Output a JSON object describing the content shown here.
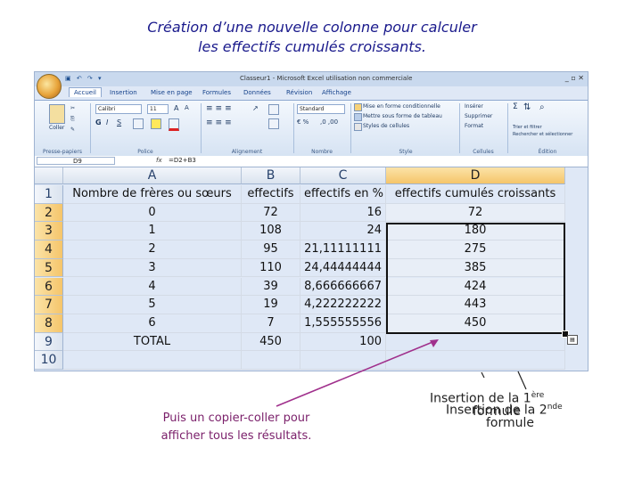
{
  "slide": {
    "title_line1": "Création d’une nouvelle colonne pour calculer",
    "title_line2": "les effectifs cumulés croissants."
  },
  "window": {
    "title": "Classeur1 - Microsoft Excel utilisation non commerciale",
    "tabs": [
      "Accueil",
      "Insertion",
      "Mise en page",
      "Formules",
      "Données",
      "Révision",
      "Affichage"
    ],
    "active_tab": "Accueil"
  },
  "ribbon": {
    "paste_label": "Coller",
    "font_name": "Calibri",
    "font_size": "11",
    "number_format": "Standard",
    "styles": [
      "Mise en forme conditionnelle",
      "Mettre sous forme de tableau",
      "Styles de cellules"
    ],
    "cells": [
      "Insérer",
      "Supprimer",
      "Format"
    ],
    "editing": [
      "Trier et filtrer",
      "Rechercher et sélectionner"
    ],
    "group_labels": [
      "Presse-papiers",
      "Police",
      "Alignement",
      "Nombre",
      "Style",
      "Cellules",
      "Édition"
    ]
  },
  "formula_bar": {
    "name_box": "D9",
    "fx": "fx",
    "value": "=D2+B3"
  },
  "grid": {
    "columns": [
      "A",
      "B",
      "C",
      "D"
    ],
    "selected_column": "D",
    "rows": [
      {
        "n": "1",
        "a": "Nombre de frères ou sœurs",
        "b": "effectifs",
        "c": "effectifs en %",
        "d": "effectifs cumulés croissants"
      },
      {
        "n": "2",
        "a": "0",
        "b": "72",
        "c": "16",
        "d": "72"
      },
      {
        "n": "3",
        "a": "1",
        "b": "108",
        "c": "24",
        "d": "180"
      },
      {
        "n": "4",
        "a": "2",
        "b": "95",
        "c": "21,11111111",
        "d": "275"
      },
      {
        "n": "5",
        "a": "3",
        "b": "110",
        "c": "24,44444444",
        "d": "385"
      },
      {
        "n": "6",
        "a": "4",
        "b": "39",
        "c": "8,666666667",
        "d": "424"
      },
      {
        "n": "7",
        "a": "5",
        "b": "19",
        "c": "4,222222222",
        "d": "443"
      },
      {
        "n": "8",
        "a": "6",
        "b": "7",
        "c": "1,555555556",
        "d": "450"
      },
      {
        "n": "9",
        "a": "TOTAL",
        "b": "450",
        "c": "100",
        "d": ""
      },
      {
        "n": "10",
        "a": "",
        "b": "",
        "c": "",
        "d": ""
      }
    ]
  },
  "annotations": {
    "copy_paste_line1": "Puis un copier-coller pour",
    "copy_paste_line2": "afficher tous les résultats.",
    "first_formula_prefix": "Insertion de la 1",
    "first_formula_sup": "ère",
    "first_formula_suffix": "formule",
    "second_formula_prefix": "Insertion de la 2",
    "second_formula_sup": "nde",
    "second_formula_suffix": "formule"
  },
  "colors": {
    "title": "#1a1a8c",
    "note": "#7a1f6a",
    "arrow": "#a0308c",
    "selected_header": "#f5c56a"
  }
}
